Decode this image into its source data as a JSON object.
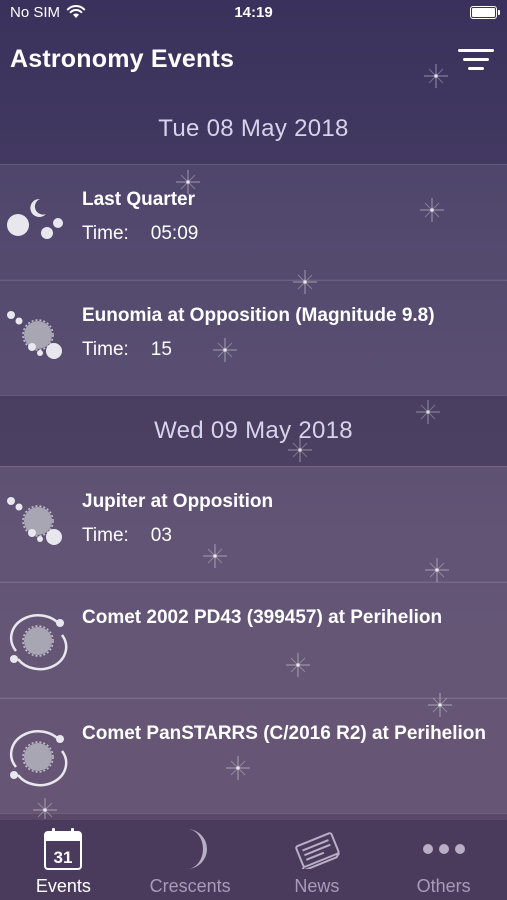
{
  "status_bar": {
    "carrier": "No SIM",
    "time": "14:19"
  },
  "header": {
    "title": "Astronomy Events",
    "filter_icon": "filter-icon"
  },
  "sections": [
    {
      "date": "Tue 08 May 2018",
      "events": [
        {
          "name": "Last Quarter",
          "time_label": "Time:",
          "time": "05:09",
          "icon": "moon-phases-icon"
        },
        {
          "name": "Eunomia at Opposition (Magnitude 9.8)",
          "time_label": "Time:",
          "time": "15",
          "icon": "opposition-icon"
        }
      ]
    },
    {
      "date": "Wed 09 May 2018",
      "events": [
        {
          "name": "Jupiter at Opposition",
          "time_label": "Time:",
          "time": "03",
          "icon": "opposition-icon"
        },
        {
          "name": "Comet 2002 PD43 (399457) at Perihelion",
          "icon": "perihelion-icon"
        },
        {
          "name": "Comet PanSTARRS (C/2016 R2) at Perihelion",
          "icon": "perihelion-icon"
        }
      ]
    }
  ],
  "tabs": [
    {
      "label": "Events",
      "icon": "calendar-icon",
      "calendar_day": "31",
      "active": true
    },
    {
      "label": "Crescents",
      "icon": "crescent-moon-icon",
      "active": false
    },
    {
      "label": "News",
      "icon": "newspaper-icon",
      "active": false
    },
    {
      "label": "Others",
      "icon": "more-icon",
      "active": false
    }
  ]
}
